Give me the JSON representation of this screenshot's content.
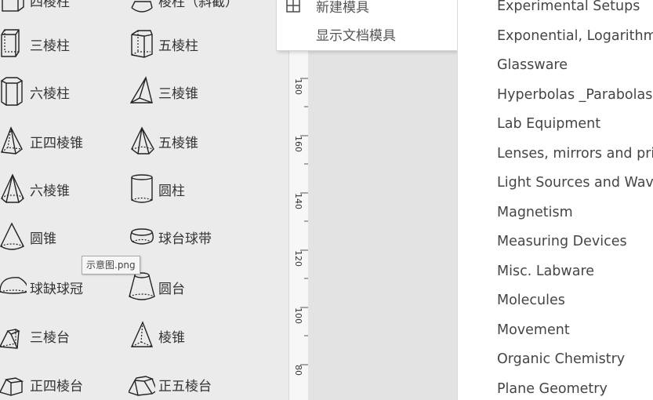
{
  "shapes": [
    {
      "label": "四棱柱",
      "icon": "quad-prism-icon"
    },
    {
      "label": "棱柱（斜截）",
      "icon": "oblique-prism-icon"
    },
    {
      "label": "三棱柱",
      "icon": "triangular-prism-icon"
    },
    {
      "label": "五棱柱",
      "icon": "pentagonal-prism-icon"
    },
    {
      "label": "六棱柱",
      "icon": "hexagonal-prism-icon"
    },
    {
      "label": "三棱锥",
      "icon": "triangular-pyramid-icon"
    },
    {
      "label": "正四棱锥",
      "icon": "square-pyramid-icon"
    },
    {
      "label": "五棱锥",
      "icon": "pentagonal-pyramid-icon"
    },
    {
      "label": "六棱锥",
      "icon": "hexagonal-pyramid-icon"
    },
    {
      "label": "圆柱",
      "icon": "cylinder-icon"
    },
    {
      "label": "圆锥",
      "icon": "cone-icon"
    },
    {
      "label": "球台球带",
      "icon": "spherical-zone-icon"
    },
    {
      "label": "球缺球冠",
      "icon": "spherical-cap-icon"
    },
    {
      "label": "圆台",
      "icon": "frustum-icon"
    },
    {
      "label": "三棱台",
      "icon": "triangular-frustum-icon"
    },
    {
      "label": "棱锥",
      "icon": "pyramid-icon"
    },
    {
      "label": "正四棱台",
      "icon": "square-frustum-icon"
    },
    {
      "label": "正五棱台",
      "icon": "pentagonal-frustum-icon"
    }
  ],
  "tooltip": {
    "text": "示意图.png"
  },
  "ruler": {
    "labels": [
      "180",
      "160",
      "140",
      "120",
      "100",
      "80"
    ]
  },
  "context_menu": {
    "items": [
      {
        "label": "新建模具",
        "icon": "grid-icon"
      },
      {
        "label": "显示文档模具",
        "icon": ""
      }
    ]
  },
  "stencil_list": {
    "items": [
      "Experimental Setups",
      "Exponential, Logarithm",
      "Glassware",
      "Hyperbolas _Parabolas",
      "Lab Equipment",
      "Lenses, mirrors and pri",
      "Light Sources and Wav",
      "Magnetism",
      "Measuring Devices",
      "Misc. Labware",
      "Molecules",
      "Movement",
      "Organic Chemistry",
      "Plane Geometry"
    ]
  }
}
